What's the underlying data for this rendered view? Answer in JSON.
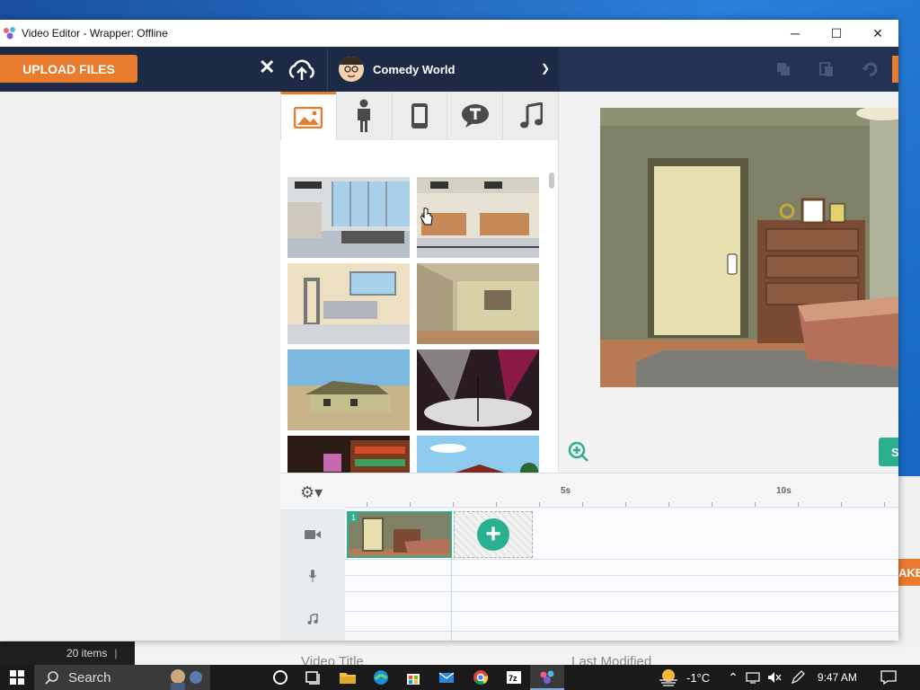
{
  "window": {
    "title": "Video Editor - Wrapper: Offline",
    "minimize": "─",
    "maximize": "☐",
    "close": "✕"
  },
  "topbar": {
    "upload_label": "UPLOAD FILES",
    "close_label": "✕",
    "theme_name": "Comedy World"
  },
  "library": {
    "tabs": [
      {
        "name": "backgrounds",
        "icon": "image-icon",
        "active": true
      },
      {
        "name": "characters",
        "icon": "person-icon",
        "active": false
      },
      {
        "name": "props",
        "icon": "phone-icon",
        "active": false
      },
      {
        "name": "text",
        "icon": "speech-bubble-icon",
        "active": false
      },
      {
        "name": "sound",
        "icon": "music-note-icon",
        "active": false
      }
    ]
  },
  "stage": {
    "save_label": "S"
  },
  "timeline": {
    "ticks": [
      "5s",
      "10s"
    ],
    "scene_number": "1",
    "add_label": "+"
  },
  "background_window": {
    "item_count": "20 items",
    "col_video_title": "Video Title",
    "col_last_modified": "Last Modified",
    "right_button": "AKE"
  },
  "taskbar": {
    "search_label": "Search",
    "temperature": "-1°C",
    "time": "9:47 AM"
  },
  "colors": {
    "accent_orange": "#e97b2f",
    "accent_teal": "#2bb08f",
    "topbar_navy": "#1d2a45"
  }
}
